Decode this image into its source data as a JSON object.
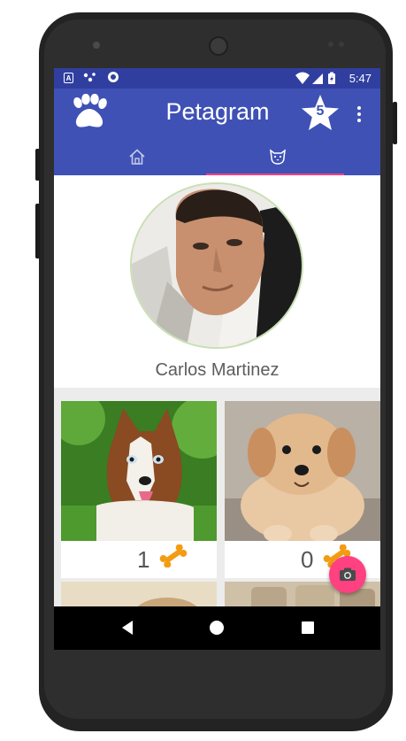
{
  "status_bar": {
    "notification_letter": "A",
    "time": "5:47"
  },
  "app_bar": {
    "title": "Petagram",
    "favorites_count": "5",
    "icons": [
      "paw-icon",
      "star-icon",
      "overflow-menu-icon"
    ]
  },
  "tabs": [
    {
      "name": "home",
      "icon": "home-icon",
      "selected": false
    },
    {
      "name": "profile",
      "icon": "dog-face-icon",
      "selected": true
    }
  ],
  "profile": {
    "name": "Carlos Martinez"
  },
  "pets": [
    {
      "photo": "husky",
      "likes": "1",
      "like_icon": "bone-icon"
    },
    {
      "photo": "puppy",
      "likes": "0",
      "like_icon": "bone-icon"
    },
    {
      "photo": "dog-partial"
    },
    {
      "photo": "corks-partial"
    }
  ],
  "fab": {
    "icon": "camera-icon"
  },
  "colors": {
    "primary": "#3f51b5",
    "primary_dark": "#303f9f",
    "accent": "#ff4081",
    "bone": "#f39c12"
  }
}
